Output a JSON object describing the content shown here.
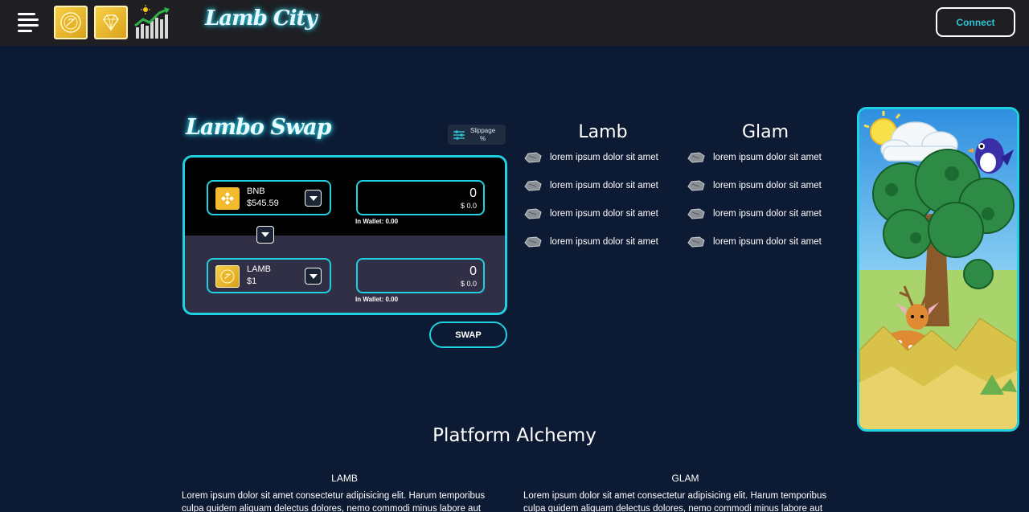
{
  "header": {
    "logo_text": "Lamb City",
    "connect_label": "Connect",
    "icons": [
      "menu-icon",
      "lamb-coin-icon",
      "glam-gem-icon",
      "chart-growth-icon"
    ]
  },
  "swap": {
    "title": "Lambo Swap",
    "slippage_label": "Slippage",
    "slippage_unit": "%",
    "from": {
      "symbol": "BNB",
      "price": "$545.59",
      "amount": "0",
      "usd": "$ 0.0",
      "wallet": "In Wallet: 0.00"
    },
    "to": {
      "symbol": "LAMB",
      "price": "$1",
      "amount": "0",
      "usd": "$ 0.0",
      "wallet": "In Wallet: 0.00"
    },
    "swap_label": "SWAP"
  },
  "features": {
    "lamb": {
      "title": "Lamb",
      "items": [
        "lorem ipsum dolor sit amet",
        "lorem ipsum dolor sit amet",
        "lorem ipsum dolor sit amet",
        "lorem ipsum dolor sit amet"
      ]
    },
    "glam": {
      "title": "Glam",
      "items": [
        "lorem ipsum dolor sit amet",
        "lorem ipsum dolor sit amet",
        "lorem ipsum dolor sit amet",
        "lorem ipsum dolor sit amet"
      ]
    }
  },
  "alchemy": {
    "title": "Platform Alchemy",
    "lamb": {
      "title": "LAMB",
      "line1": "Lorem ipsum dolor sit amet consectetur adipisicing elit. Harum temporibus",
      "line2": "culpa quidem aliquam delectus dolores, nemo commodi minus labore aut"
    },
    "glam": {
      "title": "GLAM",
      "line1": "Lorem ipsum dolor sit amet consectetur adipisicing elit. Harum temporibus",
      "line2": "culpa quidem aliquam delectus dolores, nemo commodi minus labore aut"
    }
  },
  "colors": {
    "background": "#0d1a33",
    "header": "#1e1e23",
    "accent": "#1fd0e0",
    "connect_text": "#2ec4d6",
    "coin_gold": "#f2c230"
  }
}
